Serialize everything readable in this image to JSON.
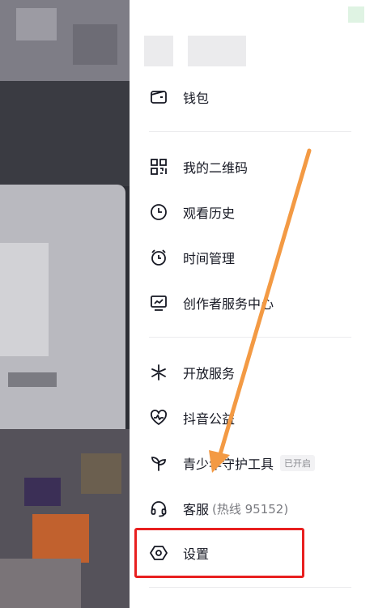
{
  "drawer": {
    "wallet_label": "钱包",
    "items_group2": [
      {
        "label": "我的二维码",
        "icon": "qr-code-icon"
      },
      {
        "label": "观看历史",
        "icon": "clock-icon"
      },
      {
        "label": "时间管理",
        "icon": "alarm-clock-icon"
      },
      {
        "label": "创作者服务中心",
        "icon": "chart-monitor-icon"
      }
    ],
    "items_group3": [
      {
        "label": "开放服务",
        "icon": "sparkle-icon"
      },
      {
        "label": "抖音公益",
        "icon": "heart-pulse-icon"
      },
      {
        "label": "青少年守护工具",
        "icon": "sprout-icon",
        "badge": "已开启"
      },
      {
        "label": "客服",
        "icon": "headset-icon",
        "hotline": "(热线 95152)"
      },
      {
        "label": "设置",
        "icon": "settings-hexagon-icon"
      }
    ]
  },
  "colors": {
    "highlight": "#e81f1f",
    "arrow": "#f39a44",
    "text": "#161823"
  }
}
